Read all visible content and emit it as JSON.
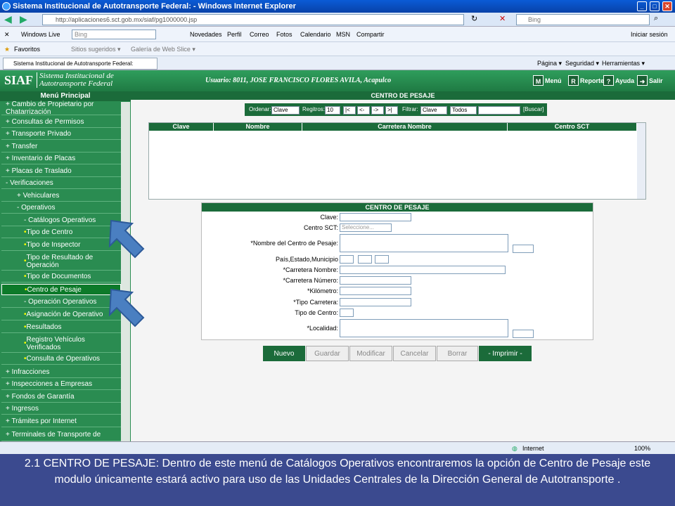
{
  "window": {
    "title": "Sistema Institucional de Autotransporte Federal: - Windows Internet Explorer"
  },
  "address": {
    "url": "http://aplicaciones6.sct.gob.mx/siaf/pg1000000.jsp",
    "search_placeholder": "Bing"
  },
  "links_bar": {
    "windows_live": "Windows Live",
    "bing": "Bing",
    "items": [
      "Novedades",
      "Perfil",
      "Correo",
      "Fotos",
      "Calendario",
      "MSN",
      "Compartir"
    ],
    "signin": "Iniciar sesión"
  },
  "favorites_bar": {
    "favorites": "Favoritos",
    "sites": "Sitios sugeridos ▾",
    "gallery": "Galería de Web Slice ▾"
  },
  "tab": {
    "title": "Sistema Institucional de Autotransporte Federal:"
  },
  "cmd": {
    "page": "Página ▾",
    "security": "Seguridad ▾",
    "tools": "Herramientas ▾"
  },
  "siaf": {
    "logo": "SIAF",
    "name1": "Sistema Institucional de",
    "name2": "Autotransporte Federal",
    "user": "Usuario: 8011, JOSE FRANCISCO FLORES AVILA, Acapulco",
    "menu": "Menú",
    "report": "Reporte",
    "help": "Ayuda",
    "exit": "Salir"
  },
  "menu": {
    "title": "Menú Principal",
    "items": [
      "+ Cambio de Propietario por Chatarrización",
      "+ Consultas de Permisos",
      "+ Transporte Privado",
      "+ Transfer",
      "+ Inventario de Placas",
      "+ Placas de Traslado",
      "- Verificaciones",
      "+ Vehiculares",
      "- Operativos",
      "- Catálogos Operativos",
      "Tipo de Centro",
      "Tipo de Inspector",
      "Tipo de Resultado de Operación",
      "Tipo de Documentos",
      "Centro de Pesaje",
      "- Operación Operativos",
      "Asignación de Operativo",
      "Resultados",
      "Registro Vehículos Verificados",
      "Consulta de Operativos",
      "+ Infracciones",
      "+ Inspecciones a Empresas",
      "+ Fondos de Garantía",
      "+ Ingresos",
      "+ Trámites por Internet",
      "+ Terminales de Transporte de"
    ]
  },
  "content": {
    "title": "CENTRO DE PESAJE",
    "toolbar": {
      "order": "Ordenar:",
      "order_val": "Clave",
      "records": "Regitros:",
      "records_val": "10",
      "nav": [
        "|<",
        "<-",
        "->",
        ">|"
      ],
      "filter": "Filtrar:",
      "filter_val": "Clave",
      "all": "Todos",
      "search": "[Buscar]"
    },
    "grid": {
      "columns": [
        "Clave",
        "Nombre",
        "Carretera Nombre",
        "Centro SCT"
      ]
    },
    "form": {
      "title": "CENTRO DE PESAJE",
      "labels": [
        "Clave:",
        "Centro SCT:",
        "*Nombre del Centro de Pesaje:",
        "País,Estado,Municipio",
        "*Carretera Nombre:",
        "*Carretera Número:",
        "*Kilómetro:",
        "*Tipo Carretera:",
        "Tipo de Centro:",
        "*Localidad:"
      ],
      "select_placeholder": "Seleccione..."
    },
    "actions": [
      "Nuevo",
      "Guardar",
      "Modificar",
      "Cancelar",
      "Borrar",
      "- Imprimir -"
    ]
  },
  "status": {
    "zone": "Internet",
    "zoom": "100%"
  },
  "caption": "2.1 CENTRO DE PESAJE: Dentro de este menú de Catálogos Operativos encontraremos la opción de Centro de Pesaje este modulo únicamente estará activo para uso de las Unidades Centrales de la Dirección General de Autotransporte ."
}
